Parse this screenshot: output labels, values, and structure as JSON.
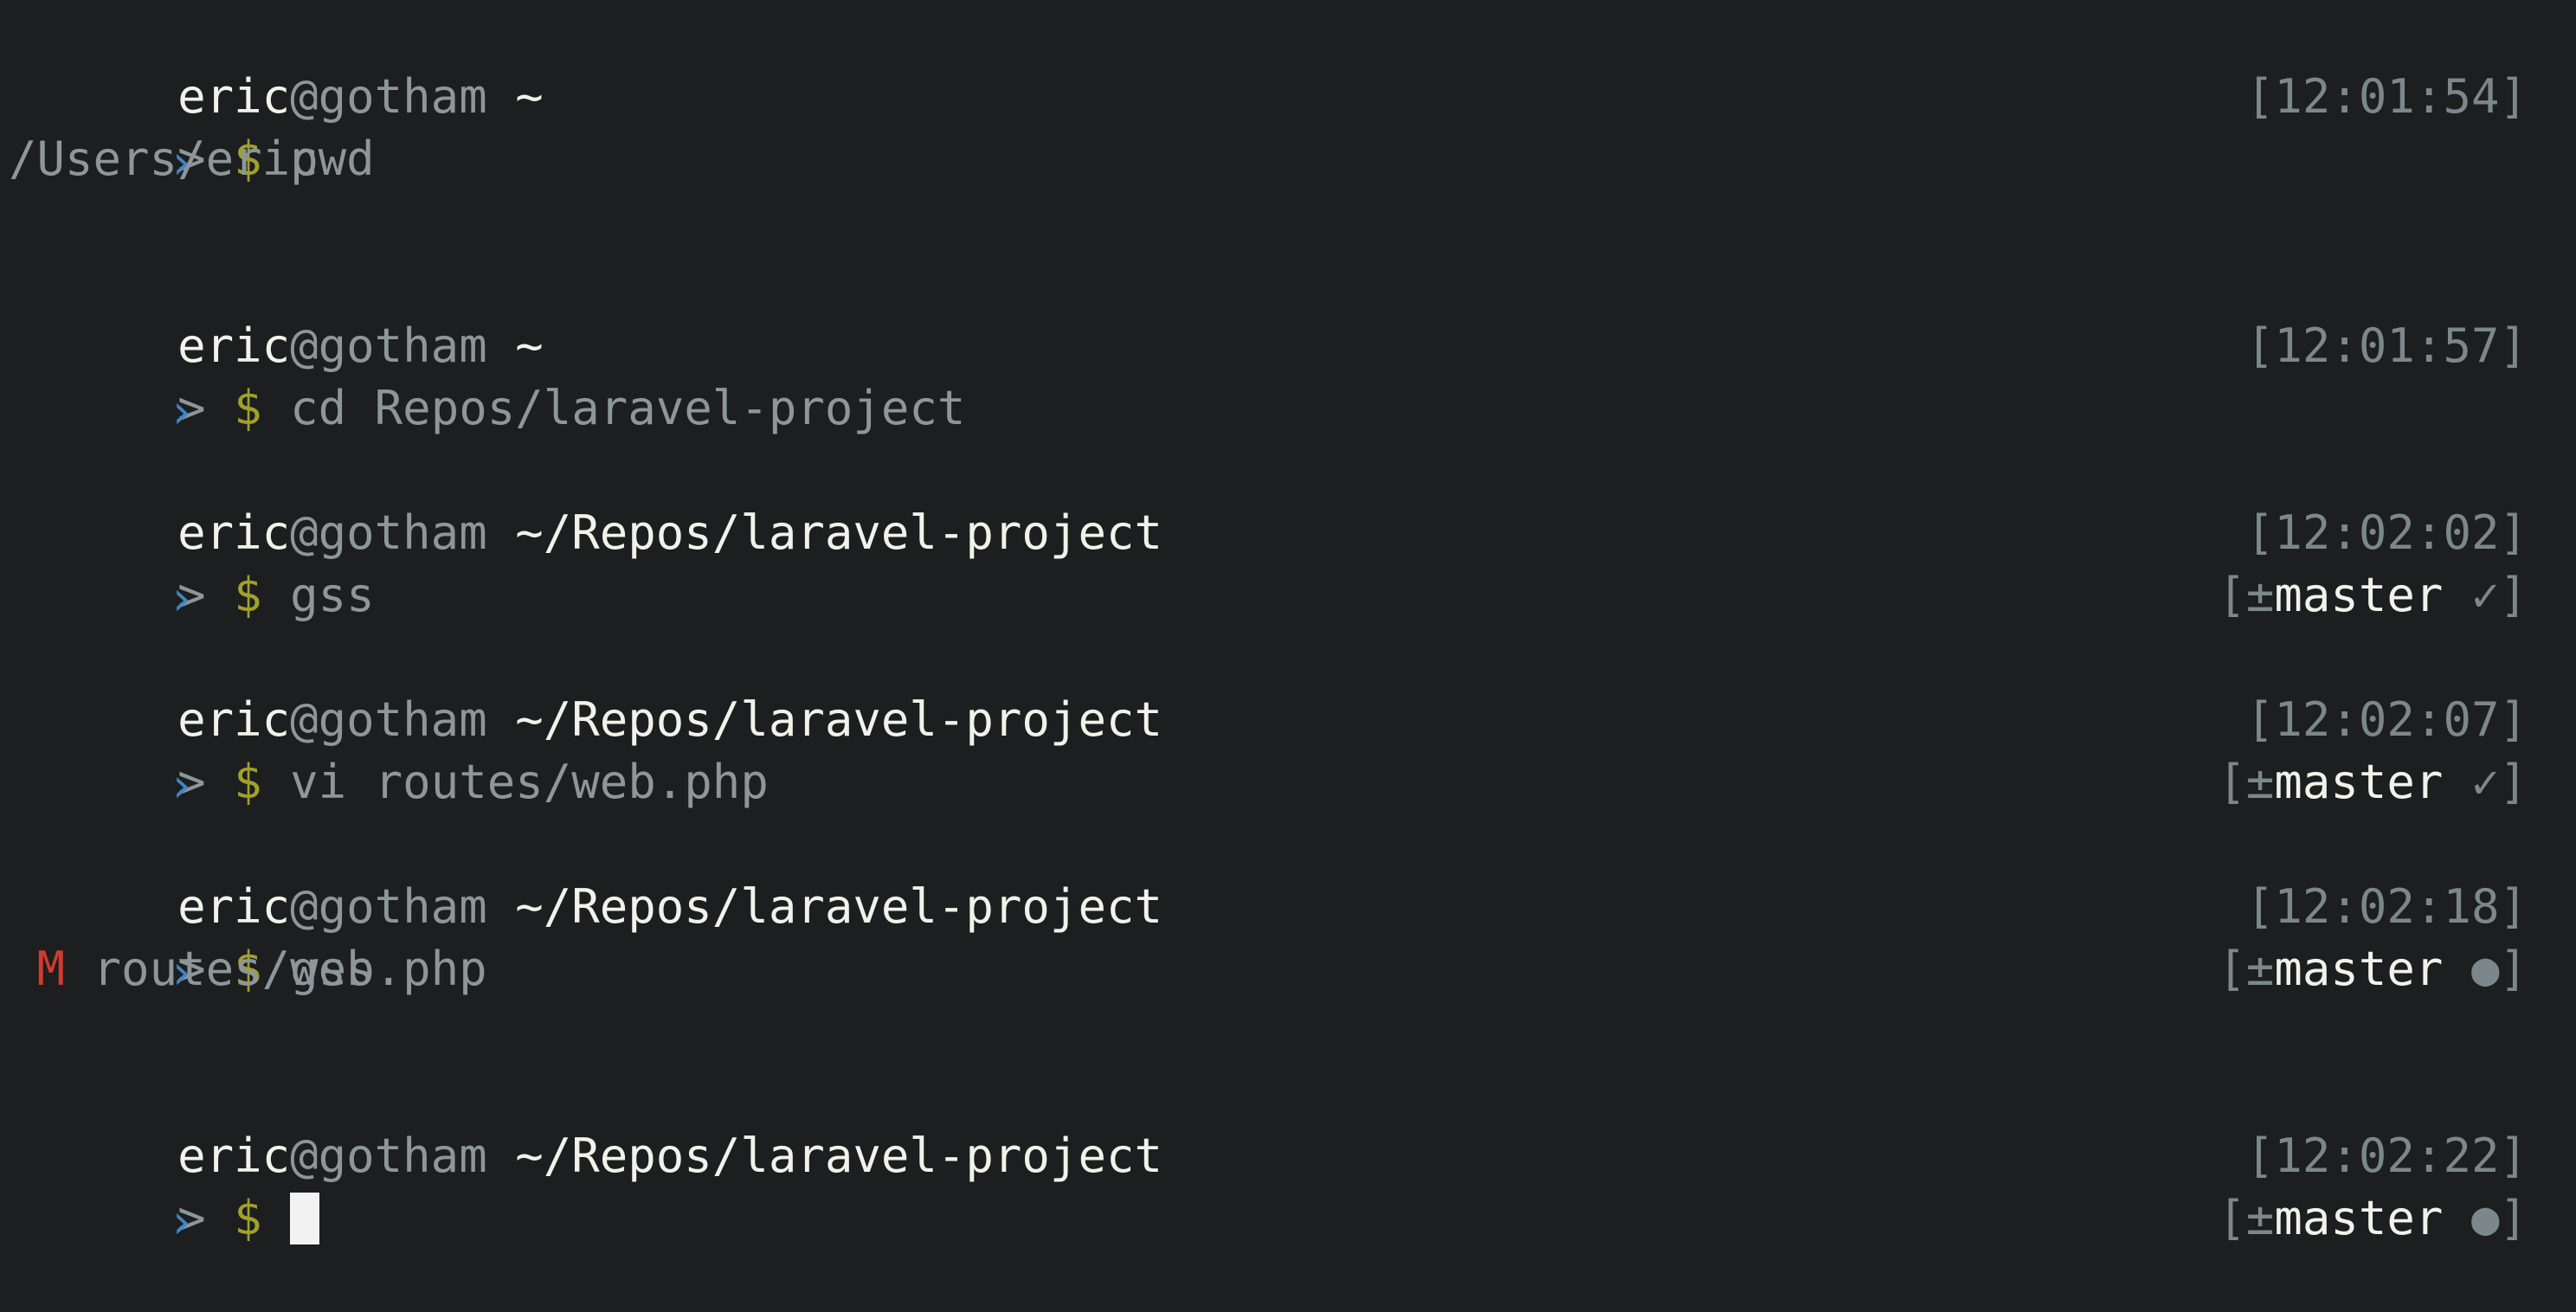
{
  "blocks": [
    {
      "user": "eric",
      "at": "@",
      "host": "gotham",
      "path": " ~",
      "time": "12:01:54",
      "prompt": ">",
      "dollar": "$",
      "command": "pwd",
      "git": null,
      "output": [
        "/Users/eric"
      ]
    },
    {
      "user": "eric",
      "at": "@",
      "host": "gotham",
      "path": " ~",
      "time": "12:01:57",
      "prompt": ">",
      "dollar": "$",
      "command": "cd Repos/laravel-project",
      "git": null,
      "output": []
    },
    {
      "user": "eric",
      "at": "@",
      "host": "gotham",
      "path": " ~/Repos/laravel-project",
      "time": "12:02:02",
      "prompt": ">",
      "dollar": "$",
      "command": "gss",
      "git": {
        "symbol": "±",
        "branch": "master",
        "status": "✓"
      },
      "output": []
    },
    {
      "user": "eric",
      "at": "@",
      "host": "gotham",
      "path": " ~/Repos/laravel-project",
      "time": "12:02:07",
      "prompt": ">",
      "dollar": "$",
      "command": "vi routes/web.php",
      "git": {
        "symbol": "±",
        "branch": "master",
        "status": "✓"
      },
      "output": []
    },
    {
      "user": "eric",
      "at": "@",
      "host": "gotham",
      "path": " ~/Repos/laravel-project",
      "time": "12:02:18",
      "prompt": ">",
      "dollar": "$",
      "command": "gss",
      "git": {
        "symbol": "±",
        "branch": "master",
        "status": "●"
      },
      "output": [],
      "status_lines": [
        {
          "flag": "M",
          "file": "routes/web.php"
        }
      ]
    },
    {
      "user": "eric",
      "at": "@",
      "host": "gotham",
      "path": " ~/Repos/laravel-project",
      "time": "12:02:22",
      "prompt": ">",
      "dollar": "$",
      "command": "",
      "git": {
        "symbol": "±",
        "branch": "master",
        "status": "●"
      },
      "output": [],
      "cursor": true
    }
  ],
  "colors": {
    "background": "#1c1e1f",
    "text_bright": "#f2f2ea",
    "text_dim": "#8d9699",
    "dollar": "#a1a02b",
    "modified": "#d13b2f",
    "prompt_marker": "#3f86c6"
  }
}
